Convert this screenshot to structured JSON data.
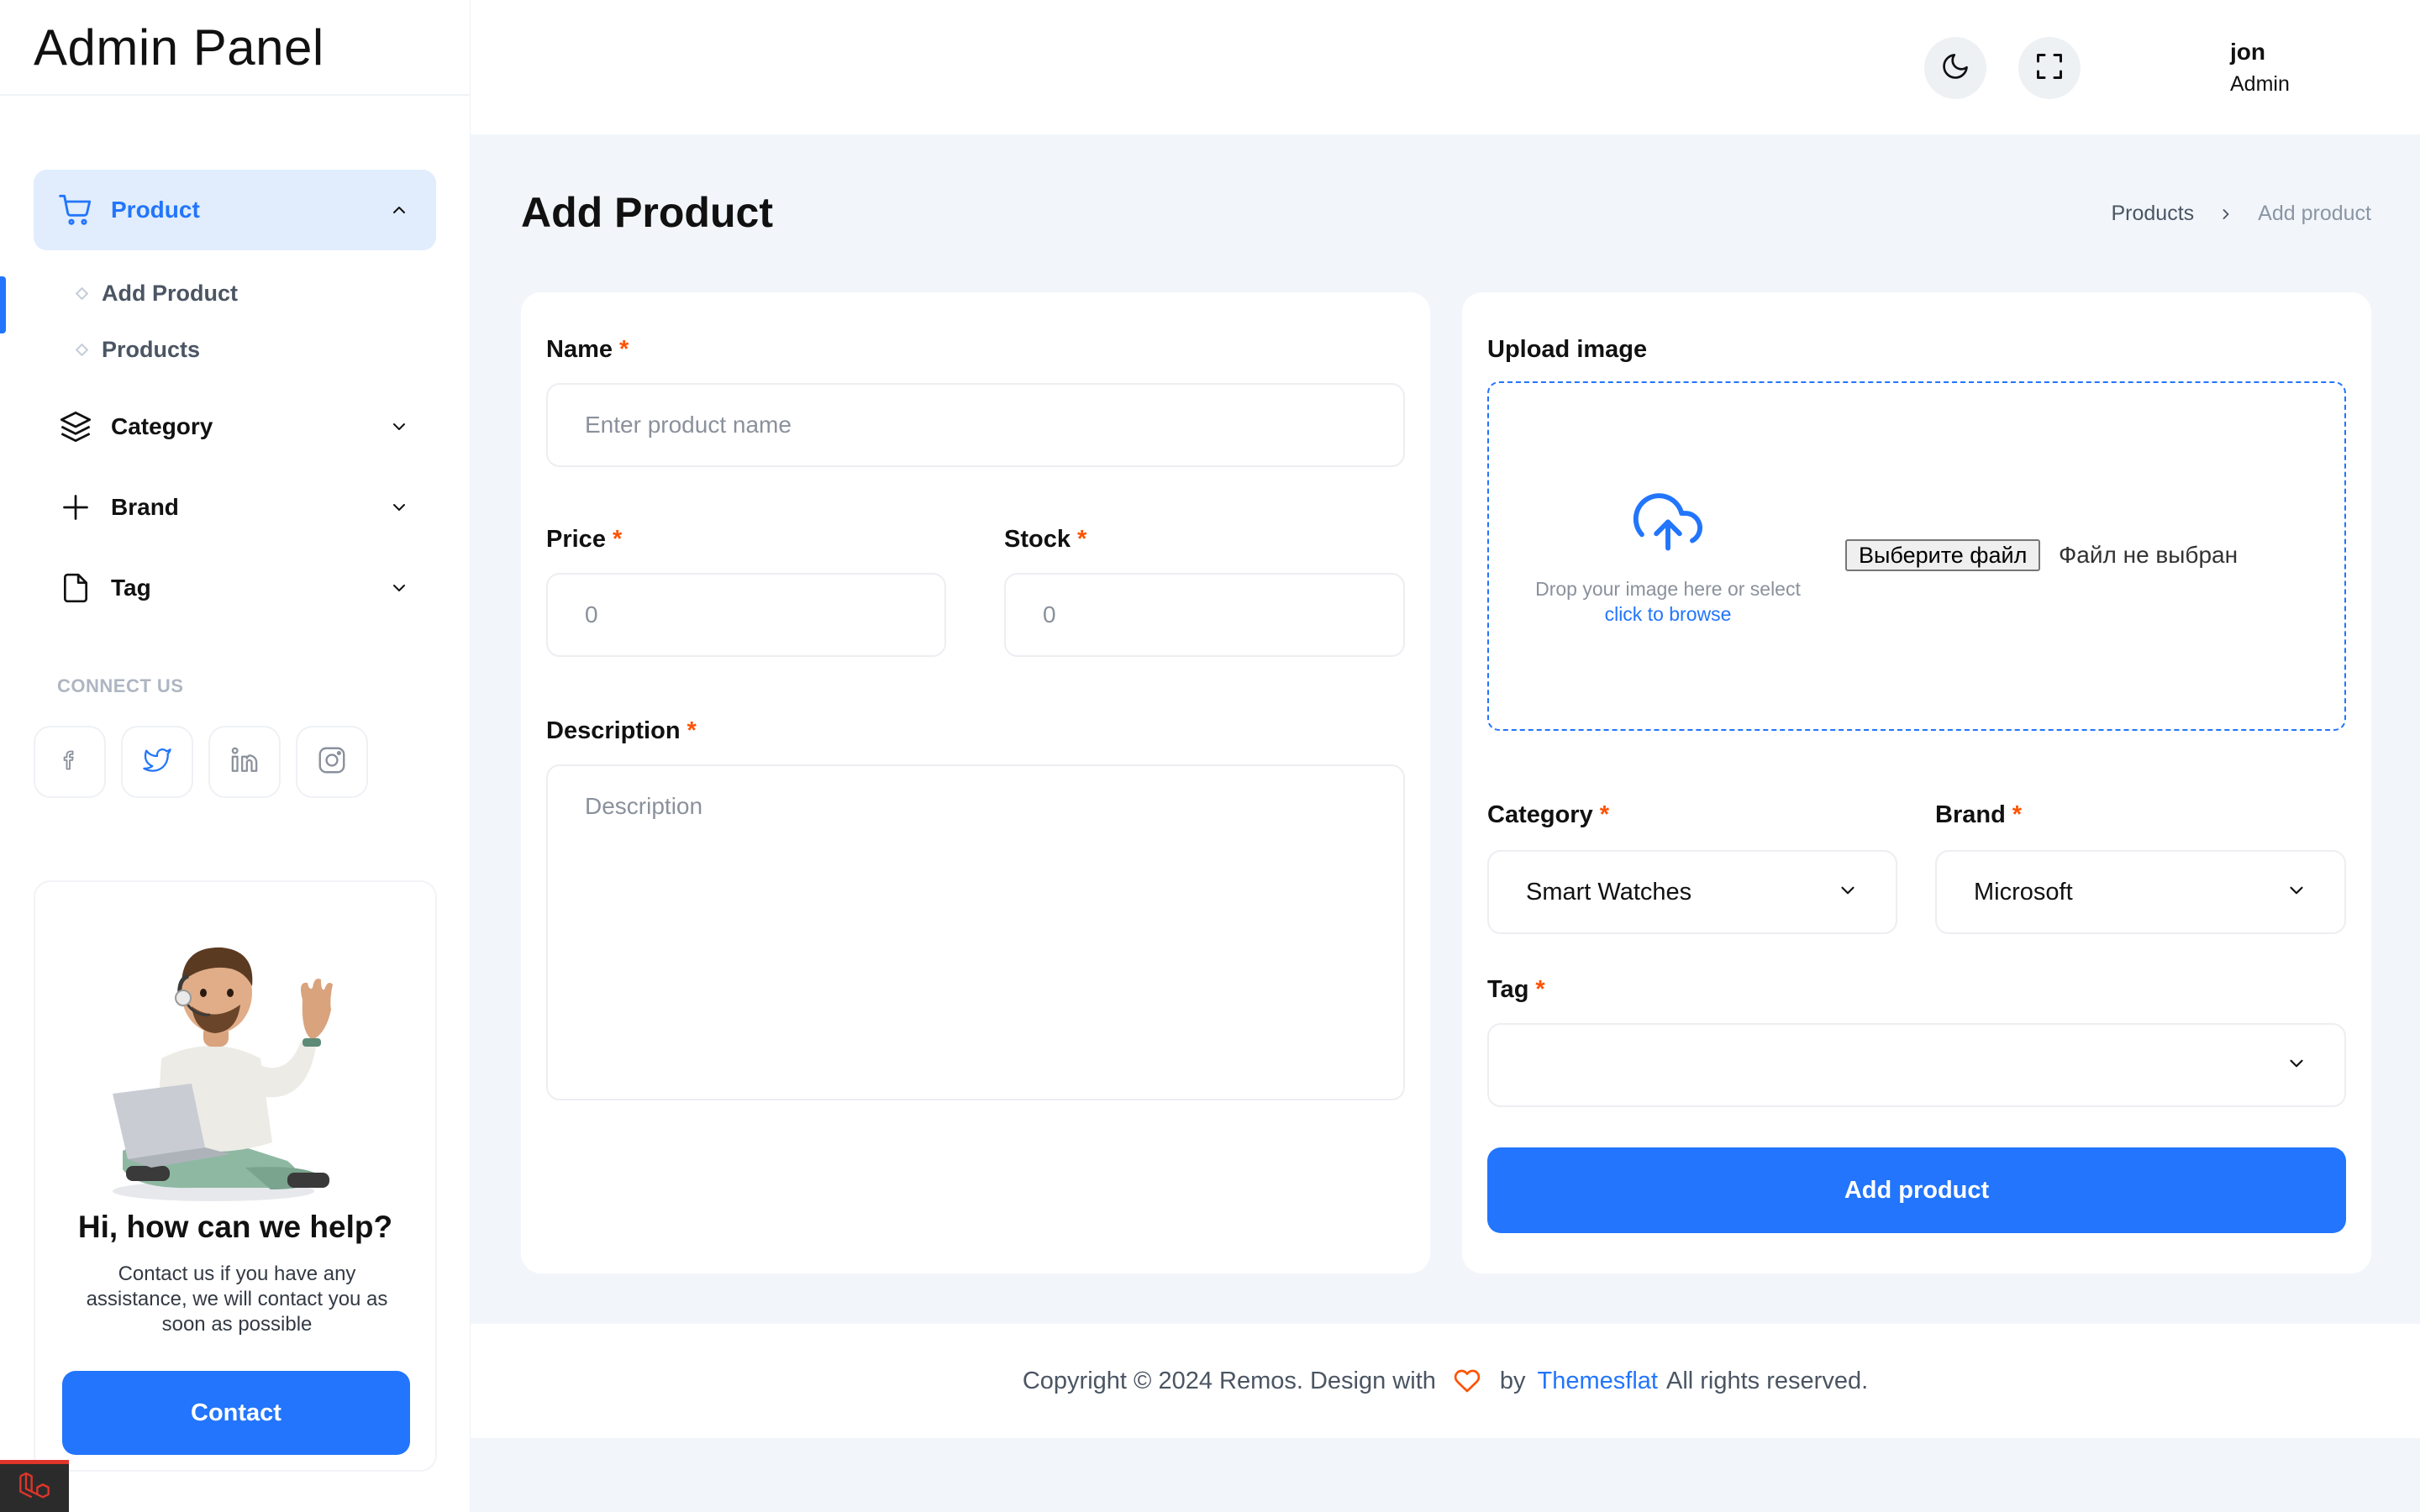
{
  "app": {
    "title": "Admin Panel"
  },
  "colors": {
    "accent": "#2275fc",
    "required": "#ff5200",
    "background": "#f2f6fb"
  },
  "sidebar": {
    "nav": [
      {
        "label": "Product",
        "icon": "cart-icon",
        "expanded": true
      },
      {
        "label": "Category",
        "icon": "layers-icon",
        "expanded": false
      },
      {
        "label": "Brand",
        "icon": "plus-icon",
        "expanded": false
      },
      {
        "label": "Tag",
        "icon": "file-icon",
        "expanded": false
      }
    ],
    "product_sub": [
      "Add Product",
      "Products"
    ],
    "connect_title": "CONNECT US",
    "socials": [
      "facebook-icon",
      "twitter-icon",
      "linkedin-icon",
      "instagram-icon"
    ],
    "help": {
      "title": "Hi, how can we help?",
      "text": "Contact us if you have any assistance, we will contact you as soon as possible",
      "button": "Contact"
    }
  },
  "header": {
    "user_name": "jon",
    "user_role": "Admin"
  },
  "page": {
    "title": "Add Product",
    "breadcrumb": [
      "Products",
      "Add product"
    ]
  },
  "form": {
    "required_mark": "*",
    "name_label": "Name",
    "name_placeholder": "Enter product name",
    "price_label": "Price",
    "price_placeholder": "0",
    "stock_label": "Stock",
    "stock_placeholder": "0",
    "description_label": "Description",
    "description_placeholder": "Description",
    "upload_label": "Upload image",
    "upload_hint": "Drop your image here or select",
    "upload_link": "click to browse",
    "file_button": "Выберите файл",
    "file_status": "Файл не выбран",
    "category_label": "Category",
    "category_value": "Smart Watches",
    "brand_label": "Brand",
    "brand_value": "Microsoft",
    "tag_label": "Tag",
    "tag_value": "",
    "submit": "Add product"
  },
  "footer": {
    "text_before": "Copyright © 2024 Remos. Design with",
    "by": "by",
    "brand": "Themesflat",
    "text_after": "All rights reserved."
  }
}
